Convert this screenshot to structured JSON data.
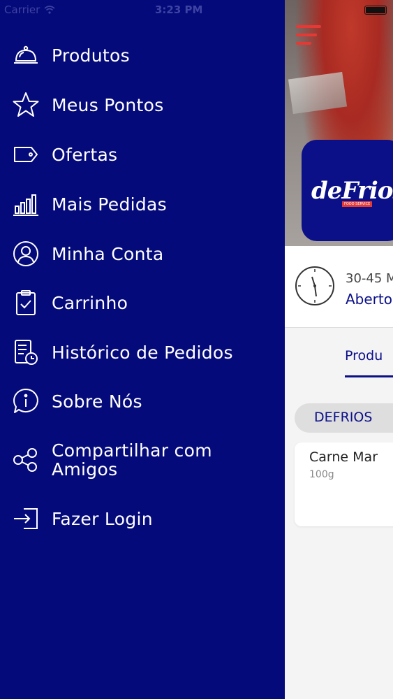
{
  "status_bar": {
    "carrier": "Carrier",
    "time": "3:23 PM"
  },
  "drawer": {
    "background": "#050A7A",
    "items": [
      {
        "label": "Produtos",
        "icon": "cloche-icon"
      },
      {
        "label": "Meus Pontos",
        "icon": "star-icon"
      },
      {
        "label": "Ofertas",
        "icon": "tag-icon"
      },
      {
        "label": "Mais Pedidas",
        "icon": "bar-chart-icon"
      },
      {
        "label": "Minha Conta",
        "icon": "user-circle-icon"
      },
      {
        "label": "Carrinho",
        "icon": "clipboard-check-icon"
      },
      {
        "label": "Histórico de Pedidos",
        "icon": "history-icon"
      },
      {
        "label": "Sobre Nós",
        "icon": "info-bubble-icon"
      },
      {
        "label": "Compartilhar com Amigos",
        "icon": "share-icon"
      },
      {
        "label": "Fazer Login",
        "icon": "login-icon"
      }
    ]
  },
  "store": {
    "logo_text": "deFrios",
    "logo_subtext": "FOOD SERVICE",
    "eta": "30-45 M",
    "open_status": "Aberto",
    "active_tab": "Produ",
    "category_chip": "DEFRIOS",
    "product": {
      "name": "Carne Mar",
      "weight": "100g"
    }
  },
  "colors": {
    "accent": "#e53935",
    "brand": "#0b0f88"
  }
}
